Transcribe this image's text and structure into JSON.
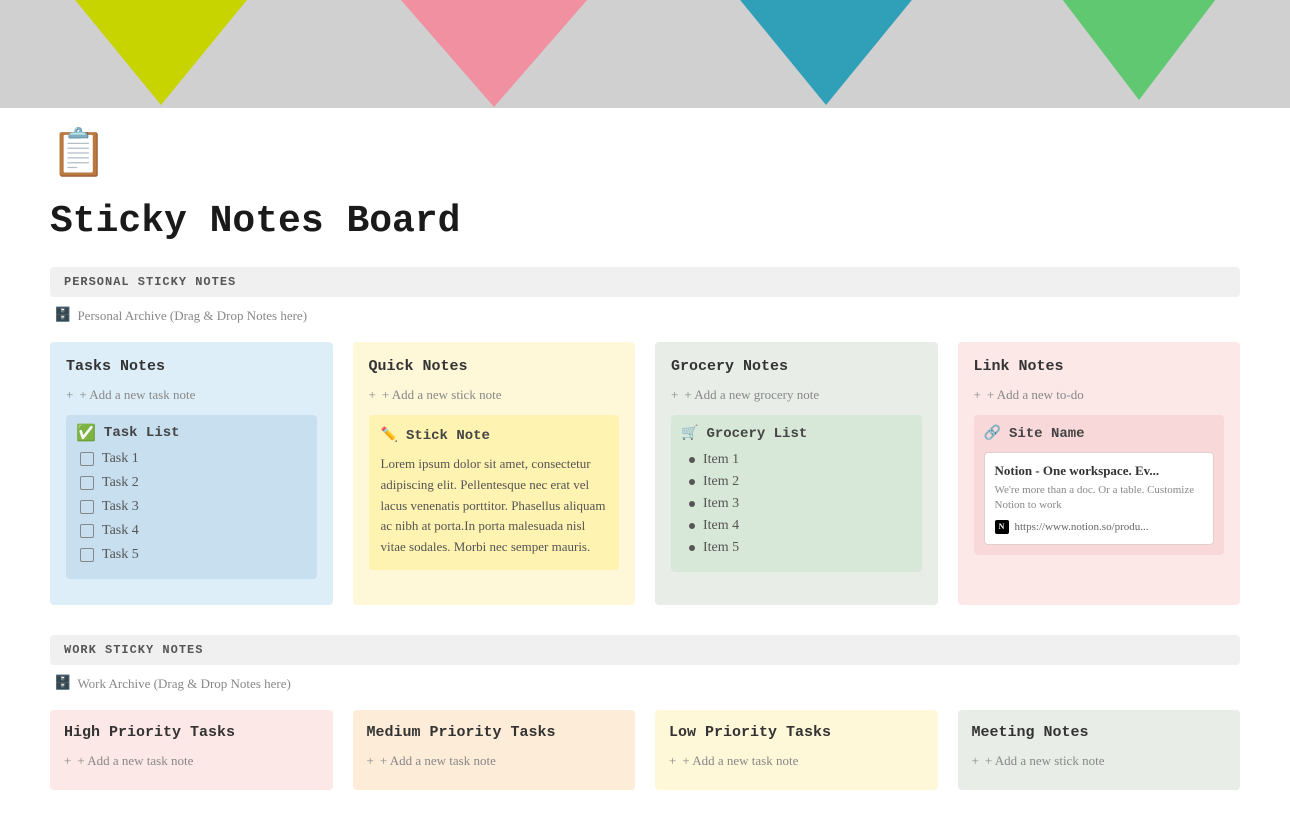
{
  "hero": {
    "triangles": [
      "yellow",
      "pink",
      "teal",
      "green"
    ]
  },
  "page": {
    "icon": "📋",
    "title": "Sticky Notes Board"
  },
  "personal_section": {
    "header": "PERSONAL STICKY NOTES",
    "archive_label": "Personal Archive (Drag & Drop Notes here)"
  },
  "columns": [
    {
      "id": "tasks-notes",
      "title": "Tasks Notes",
      "color": "blue",
      "add_label": "+ Add a new task note",
      "type": "task",
      "sub_header": "Task List",
      "items": [
        "Task 1",
        "Task 2",
        "Task 3",
        "Task 4",
        "Task 5"
      ]
    },
    {
      "id": "quick-notes",
      "title": "Quick Notes",
      "color": "yellow",
      "add_label": "+ Add a new stick note",
      "type": "note",
      "sub_header": "Stick Note",
      "body": "Lorem ipsum dolor sit amet, consectetur adipiscing elit. Pellentesque nec erat vel lacus venenatis porttitor. Phasellus aliquam ac nibh at porta.In porta malesuada nisl vitae sodales. Morbi nec semper mauris."
    },
    {
      "id": "grocery-notes",
      "title": "Grocery Notes",
      "color": "gray",
      "add_label": "+ Add a new grocery note",
      "type": "grocery",
      "sub_header": "Grocery List",
      "items": [
        "Item 1",
        "Item 2",
        "Item 3",
        "Item 4",
        "Item 5"
      ]
    },
    {
      "id": "link-notes",
      "title": "Link Notes",
      "color": "pink",
      "add_label": "+ Add a new to-do",
      "type": "link",
      "sub_header": "Site Name",
      "link": {
        "title": "Notion - One workspace. Ev...",
        "description": "We're more than a doc. Or a table. Customize Notion to work",
        "url": "https://www.notion.so/produ..."
      }
    }
  ],
  "work_section": {
    "header": "WORK STICKY NOTES",
    "archive_label": "Work Archive (Drag & Drop Notes here)"
  },
  "work_columns": [
    {
      "id": "high-priority",
      "title": "High Priority Tasks",
      "color": "light-pink",
      "add_label": "+ Add a new task note"
    },
    {
      "id": "medium-priority",
      "title": "Medium Priority Tasks",
      "color": "orange",
      "add_label": "+ Add a new task note"
    },
    {
      "id": "low-priority",
      "title": "Low Priority Tasks",
      "color": "light-yellow",
      "add_label": "+ Add a new task note"
    },
    {
      "id": "meeting-notes",
      "title": "Meeting Notes",
      "color": "gray",
      "add_label": "+ Add a new stick note"
    }
  ]
}
